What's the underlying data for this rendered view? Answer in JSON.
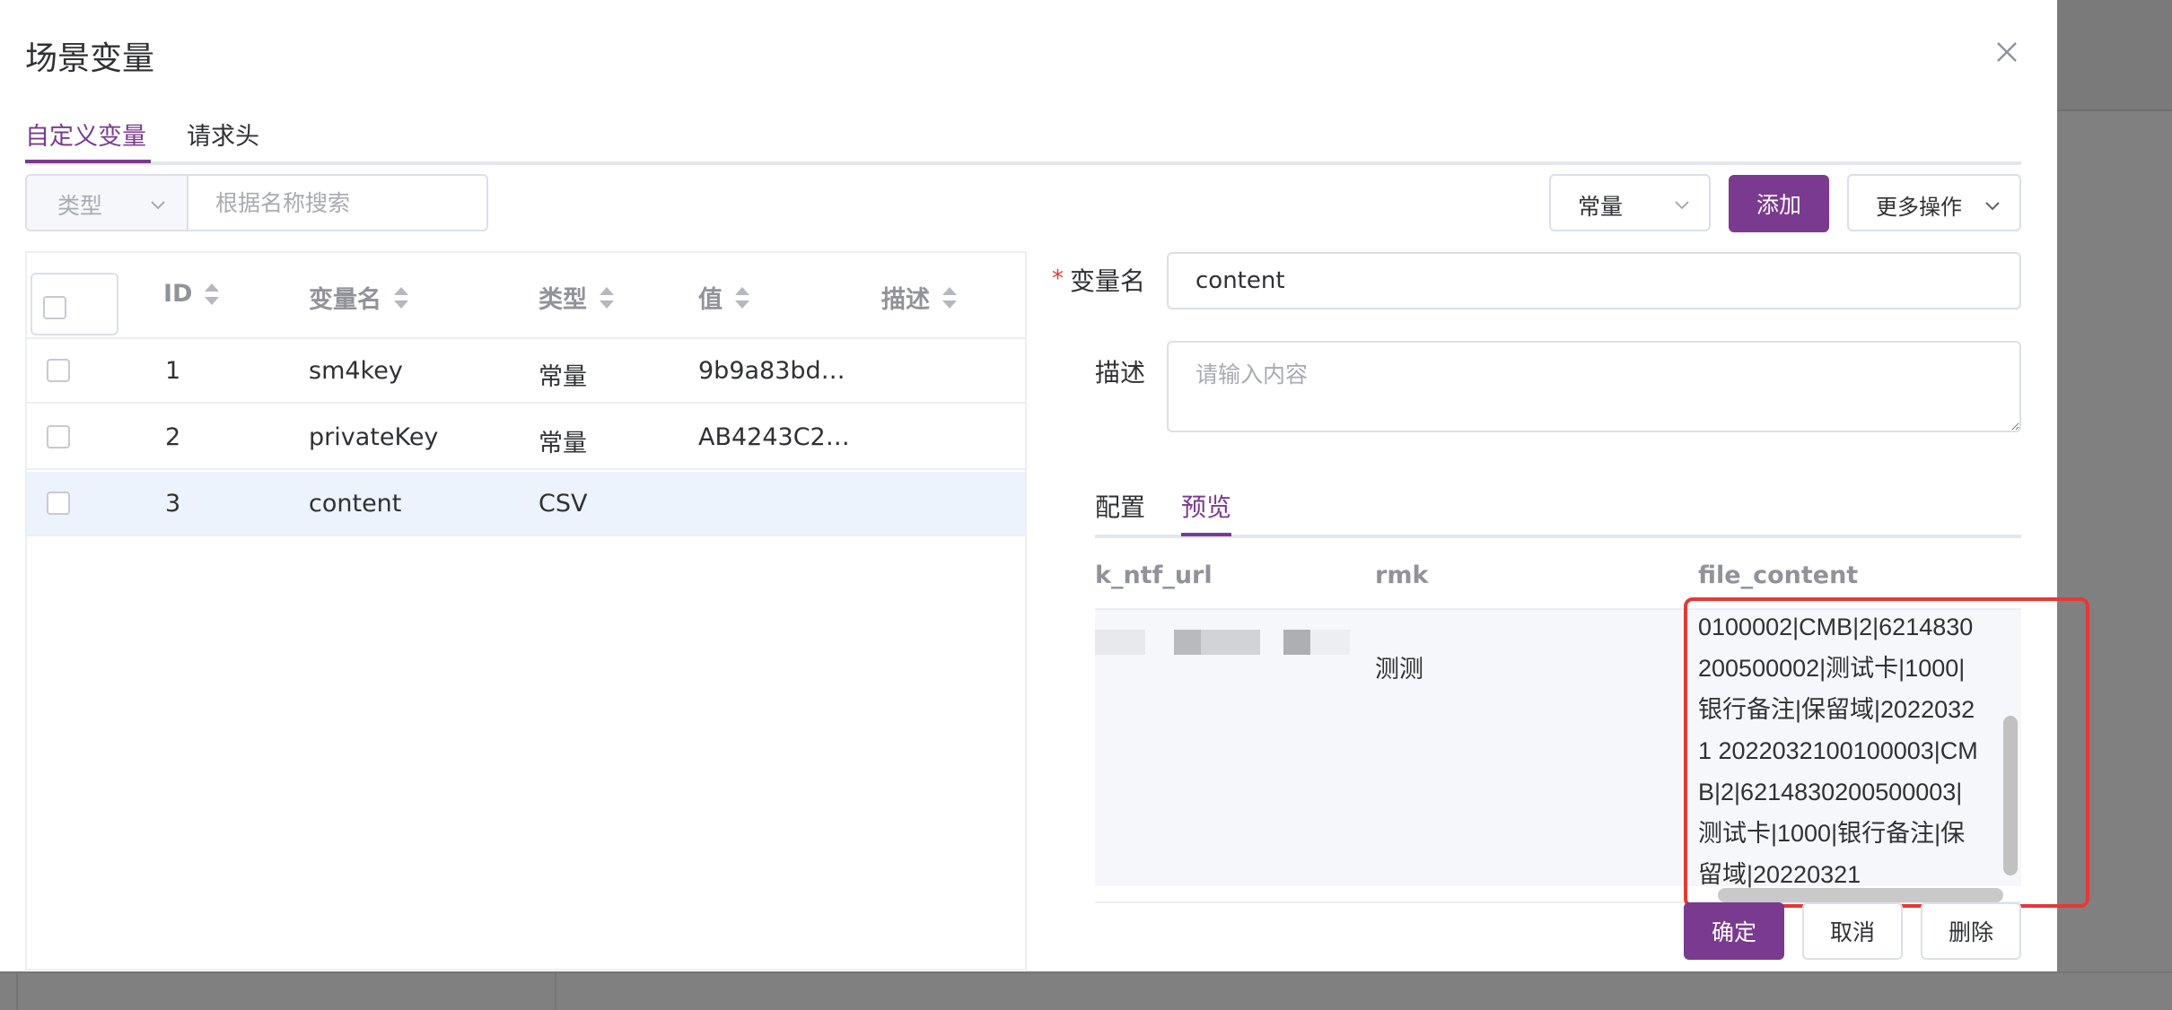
{
  "dialog": {
    "title": "场景变量"
  },
  "tabs": [
    {
      "label": "自定义变量",
      "active": true
    },
    {
      "label": "请求头",
      "active": false
    }
  ],
  "toolbar": {
    "type_filter_placeholder": "类型",
    "search_placeholder": "根据名称搜索",
    "const_select_value": "常量",
    "add_label": "添加",
    "more_label": "更多操作"
  },
  "table": {
    "columns": [
      "ID",
      "变量名",
      "类型",
      "值",
      "描述"
    ],
    "rows": [
      {
        "id": "1",
        "name": "sm4key",
        "type": "常量",
        "value": "9b9a83bd…",
        "desc": ""
      },
      {
        "id": "2",
        "name": "privateKey",
        "type": "常量",
        "value": "AB4243C2…",
        "desc": ""
      },
      {
        "id": "3",
        "name": "content",
        "type": "CSV",
        "value": "",
        "desc": "",
        "selected": true
      }
    ]
  },
  "form": {
    "name_label": "变量名",
    "name_value": "content",
    "desc_label": "描述",
    "desc_placeholder": "请输入内容",
    "subtabs": [
      {
        "label": "配置",
        "active": false
      },
      {
        "label": "预览",
        "active": true
      }
    ],
    "preview": {
      "columns": [
        "k_ntf_url",
        "rmk",
        "file_content"
      ],
      "row": {
        "rmk": "测测",
        "file_content": "0100002|CMB|2|6214830200500002|测试卡|1000|银行备注|保留域|20220321 2022032100100003|CMB|2|6214830200500003|测试卡|1000|银行备注|保留域|20220321"
      }
    },
    "confirm_label": "确定",
    "cancel_label": "取消",
    "delete_label": "删除"
  },
  "colors": {
    "accent": "#7a3a8f",
    "highlight": "#e53935",
    "selected_row": "#ecf3fc"
  }
}
